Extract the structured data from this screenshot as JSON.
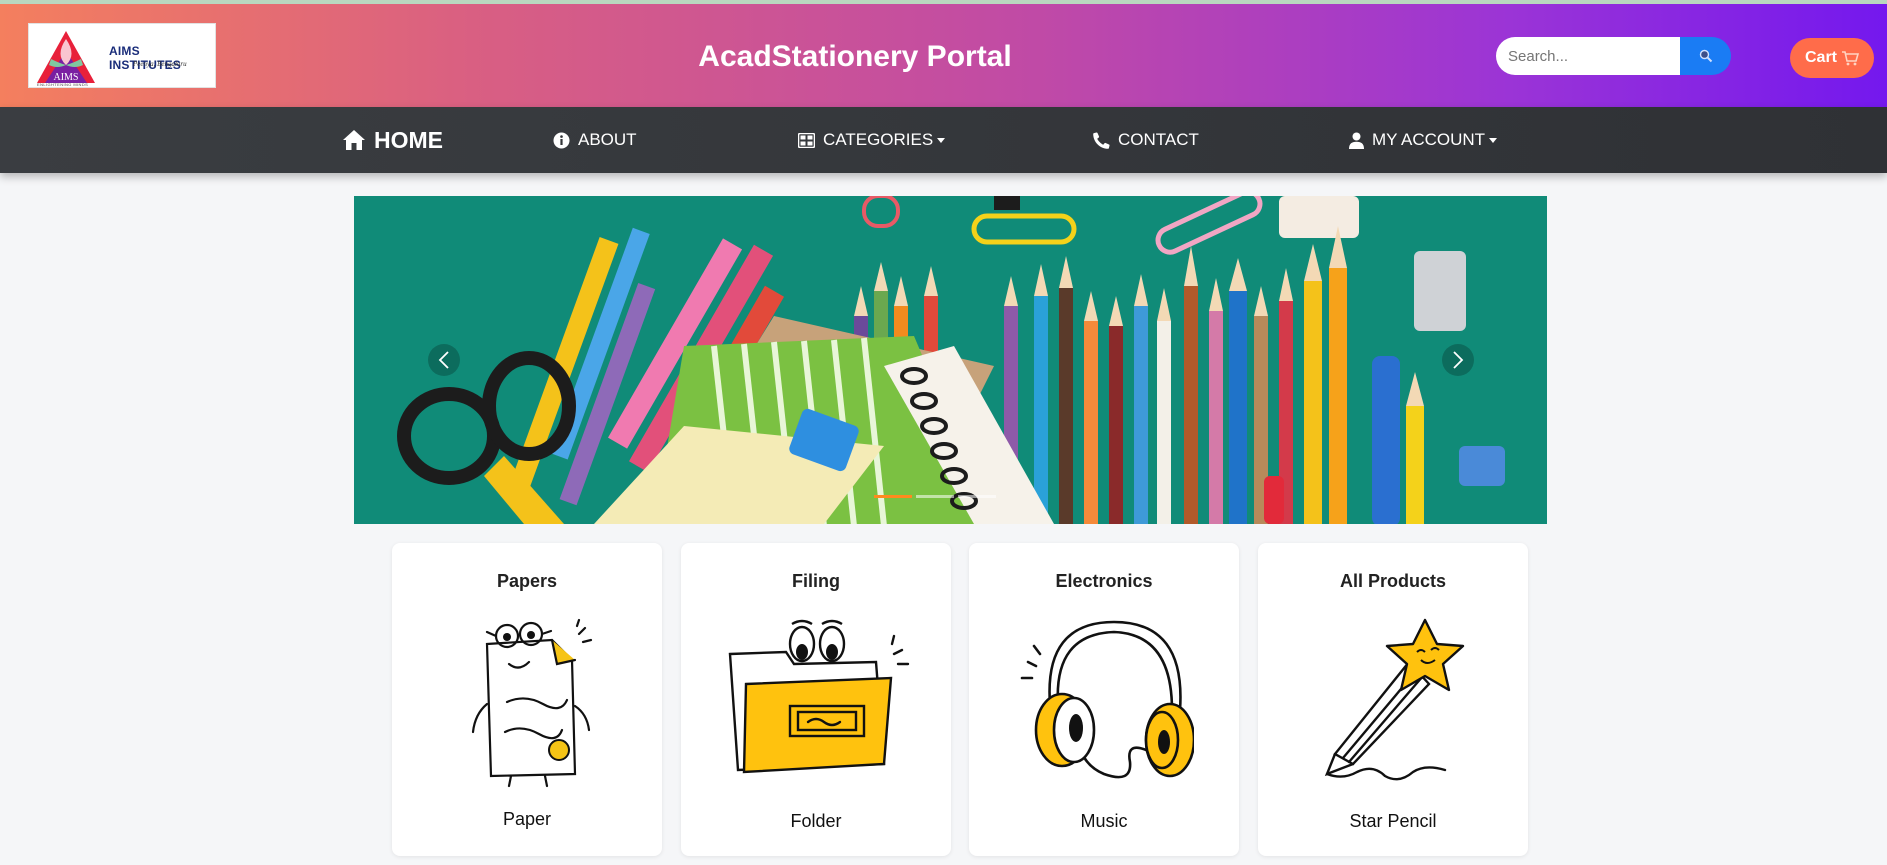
{
  "header": {
    "logo": {
      "name": "AIMS INSTITUTES",
      "subtitle": "Peenya, Bengaluru",
      "tagline": "ENLIGHTENING MINDS",
      "mark": "AIMS"
    },
    "title": "AcadStationery Portal",
    "search": {
      "placeholder": "Search...",
      "icon": "search-icon"
    },
    "cart": {
      "label": "Cart",
      "icon": "cart-icon"
    }
  },
  "nav": {
    "items": [
      {
        "label": "HOME",
        "icon": "home-icon"
      },
      {
        "label": "ABOUT",
        "icon": "info-icon"
      },
      {
        "label": "CATEGORIES",
        "icon": "grid-icon",
        "dropdown": true
      },
      {
        "label": "CONTACT",
        "icon": "phone-icon"
      },
      {
        "label": "MY ACCOUNT",
        "icon": "user-icon",
        "dropdown": true
      }
    ]
  },
  "carousel": {
    "slide_count": 3,
    "active_index": 0,
    "controls": [
      "prev-arrow-icon",
      "next-arrow-icon"
    ]
  },
  "cards": [
    {
      "title": "Papers",
      "caption": "Paper"
    },
    {
      "title": "Filing",
      "caption": "Folder"
    },
    {
      "title": "Electronics",
      "caption": "Music"
    },
    {
      "title": "All Products",
      "caption": "Star Pencil"
    }
  ],
  "colors": {
    "header_gradient": [
      "#f47f5e",
      "#c04aa6",
      "#7418ee"
    ],
    "nav_bg": "#333538",
    "search_button": "#1a7cf4",
    "cart_button": "#ff6c4a",
    "carousel_bg": "#0f8a77",
    "accent_yellow": "#ffc20e"
  }
}
